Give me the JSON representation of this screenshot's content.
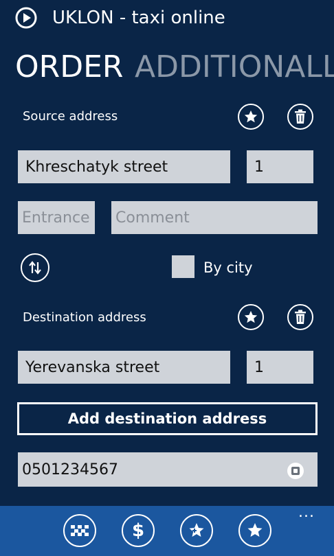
{
  "app": {
    "title": "UKLON - taxi online"
  },
  "pivot": {
    "active": "ORDER",
    "inactive": "ADDITIONALL"
  },
  "source": {
    "label": "Source address",
    "street": "Khreschatyk street",
    "house": "1",
    "entrance_placeholder": "Entrance",
    "comment_placeholder": "Comment"
  },
  "options": {
    "by_city_label": "By city",
    "by_city_checked": false
  },
  "destination": {
    "label": "Destination address",
    "street": "Yerevanska street",
    "house": "1"
  },
  "add_destination_label": "Add destination address",
  "phone": {
    "value": "0501234567"
  },
  "appbar": {
    "icons": [
      "taxi-icon",
      "dollar-icon",
      "add-favorite-icon",
      "favorites-icon"
    ],
    "dollar_glyph": "$",
    "more_label": "..."
  },
  "colors": {
    "background": "#0a2547",
    "appbar": "#1b579f",
    "field": "#cfd3d9",
    "inactive_text": "#8b98a8"
  }
}
